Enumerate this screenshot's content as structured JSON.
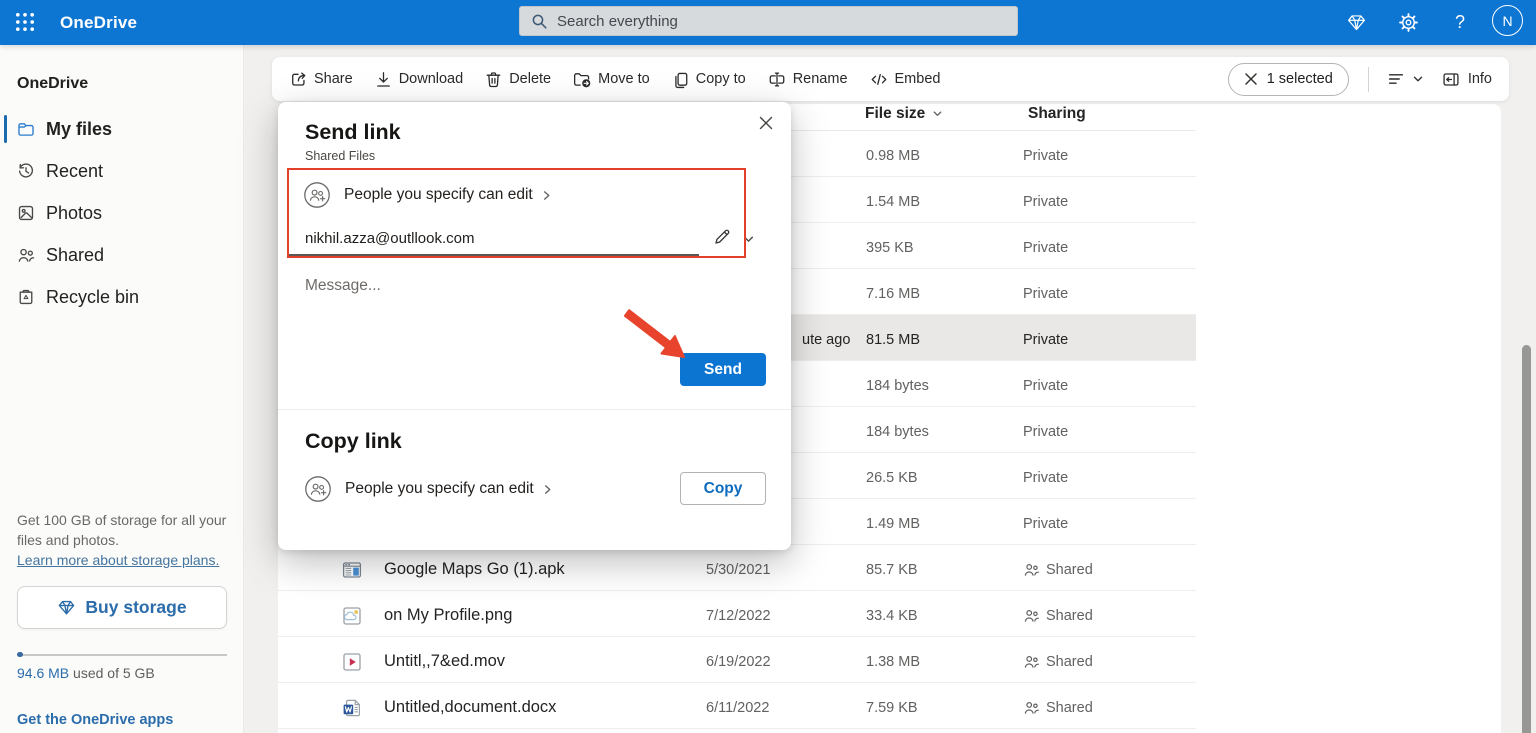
{
  "theme": {
    "accent": "#0d76d3",
    "send": "#0c75d2",
    "annotation_red": "#e8432c",
    "link_blue": "#2b6cab",
    "selected_row_bg": "#e9e8e6"
  },
  "topbar": {
    "app_title": "OneDrive",
    "search_placeholder": "Search everything",
    "avatar_initial": "N",
    "icons": [
      "waffle-icon",
      "premium-diamond-icon",
      "settings-gear-icon",
      "help-icon",
      "avatar"
    ]
  },
  "sidebar": {
    "heading": "OneDrive",
    "items": [
      {
        "label": "My files",
        "icon": "folder-icon",
        "selected": true
      },
      {
        "label": "Recent",
        "icon": "history-icon",
        "selected": false
      },
      {
        "label": "Photos",
        "icon": "image-icon",
        "selected": false
      },
      {
        "label": "Shared",
        "icon": "people-icon",
        "selected": false
      },
      {
        "label": "Recycle bin",
        "icon": "recycle-bin-icon",
        "selected": false
      }
    ],
    "promo_line1": "Get 100 GB of storage for all your",
    "promo_line2": "files and photos.",
    "promo_link": "Learn more about storage plans.",
    "buy_button": "Buy storage",
    "storage_used": "94.6 MB",
    "storage_suffix": " used of 5 GB",
    "apps_link": "Get the OneDrive apps"
  },
  "toolbar": {
    "actions": [
      {
        "label": "Share",
        "icon": "share-icon"
      },
      {
        "label": "Download",
        "icon": "download-icon"
      },
      {
        "label": "Delete",
        "icon": "delete-icon"
      },
      {
        "label": "Move to",
        "icon": "move-to-icon"
      },
      {
        "label": "Copy to",
        "icon": "copy-to-icon"
      },
      {
        "label": "Rename",
        "icon": "rename-icon"
      },
      {
        "label": "Embed",
        "icon": "embed-icon"
      }
    ],
    "selection_label": "1 selected",
    "info_label": "Info"
  },
  "dialog": {
    "title": "Send link",
    "subtitle": "Shared Files",
    "permission_label": "People you specify can edit",
    "recipient": "nikhil.azza@outllook.com",
    "message_placeholder": "Message...",
    "send_label": "Send",
    "copy_title": "Copy link",
    "copy_permission_label": "People you specify can edit",
    "copy_label": "Copy",
    "annotations": [
      "red-rectangle around permission and recipient",
      "red-arrow pointing at Send button"
    ]
  },
  "files": {
    "columns": {
      "size": "File size",
      "sharing": "Sharing"
    },
    "rows": [
      {
        "icon": "",
        "name": "",
        "modified": "",
        "size": "0.98 MB",
        "sharing": "Private",
        "selected": false
      },
      {
        "icon": "",
        "name": "",
        "modified": "",
        "size": "1.54 MB",
        "sharing": "Private",
        "selected": false
      },
      {
        "icon": "",
        "name": "",
        "modified": "",
        "size": "395 KB",
        "sharing": "Private",
        "selected": false
      },
      {
        "icon": "",
        "name": "",
        "modified": "",
        "size": "7.16 MB",
        "sharing": "Private",
        "selected": false
      },
      {
        "icon": "",
        "name": "",
        "modified": "ute ago",
        "size": "81.5 MB",
        "sharing": "Private",
        "selected": true
      },
      {
        "icon": "",
        "name": "",
        "modified": "",
        "size": "184 bytes",
        "sharing": "Private",
        "selected": false
      },
      {
        "icon": "",
        "name": "",
        "modified": "",
        "size": "184 bytes",
        "sharing": "Private",
        "selected": false
      },
      {
        "icon": "",
        "name": "",
        "modified": "",
        "size": "26.5 KB",
        "sharing": "Private",
        "selected": false
      },
      {
        "icon": "",
        "name": "",
        "modified": "",
        "size": "1.49 MB",
        "sharing": "Private",
        "selected": false
      },
      {
        "icon": "apk-file-icon",
        "name": "Google Maps Go (1).apk",
        "modified": "5/30/2021",
        "size": "85.7 KB",
        "sharing": "Shared",
        "selected": false
      },
      {
        "icon": "image-file-icon",
        "name": "on My Profile.png",
        "modified": "7/12/2022",
        "size": "33.4 KB",
        "sharing": "Shared",
        "selected": false
      },
      {
        "icon": "video-file-icon",
        "name": "Untitl,,7&ed.mov",
        "modified": "6/19/2022",
        "size": "1.38 MB",
        "sharing": "Shared",
        "selected": false
      },
      {
        "icon": "word-file-icon",
        "name": "Untitled,document.docx",
        "modified": "6/11/2022",
        "size": "7.59 KB",
        "sharing": "Shared",
        "selected": false
      }
    ]
  },
  "scrollbar": {
    "visible": true
  }
}
